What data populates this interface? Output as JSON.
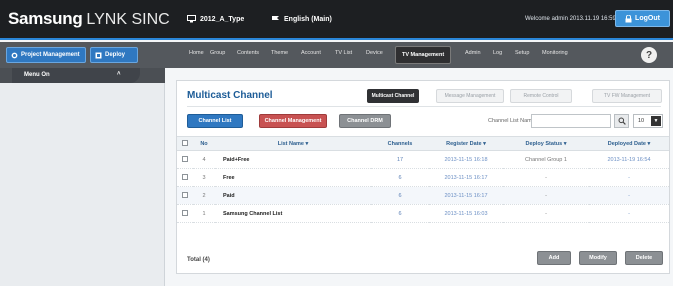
{
  "header": {
    "logo_brand": "Samsung",
    "logo_product": "LYNK SINC",
    "project": "2012_A_Type",
    "language": "English (Main)",
    "welcome": "Welcome admin 2013.11.19 16:59",
    "logout_label": "LogOut"
  },
  "sidebar": {
    "project_management_label": "Project Management",
    "deploy_label": "Deploy",
    "menu_on_label": "Menu On",
    "menu_on_arrow": "˄"
  },
  "nav": {
    "items": [
      "Home",
      "Group",
      "Contents",
      "Theme",
      "Account",
      "TV List",
      "Device",
      "TV Management",
      "Admin",
      "Log",
      "Setup",
      "Monitoring"
    ],
    "help": "?"
  },
  "panel": {
    "title": "Multicast Channel",
    "tabs": [
      "Multicast Channel",
      "Message Management",
      "Remote Control",
      "TV FW Management"
    ],
    "subtabs": [
      "Channel List",
      "Channel Management",
      "Channel DRM"
    ],
    "search_label": "Channel List Name",
    "search_value": "",
    "page_size": "10",
    "columns": [
      "No",
      "List Name ▾",
      "Channels",
      "Register Date ▾",
      "Deploy Status ▾",
      "Deployed Date ▾"
    ],
    "rows": [
      {
        "no": "4",
        "name": "Paid+Free",
        "channels": "17",
        "register": "2013-11-15 16:18",
        "status": "Channel Group 1",
        "deployed": "2013-11-19 16:54"
      },
      {
        "no": "3",
        "name": "Free",
        "channels": "6",
        "register": "2013-11-15 16:17",
        "status": "-",
        "deployed": "-"
      },
      {
        "no": "2",
        "name": "Paid",
        "channels": "6",
        "register": "2013-11-15 16:17",
        "status": "-",
        "deployed": "-"
      },
      {
        "no": "1",
        "name": "Samsung Channel List",
        "channels": "6",
        "register": "2013-11-15 16:03",
        "status": "-",
        "deployed": "-"
      }
    ],
    "total": "Total (4)",
    "actions": [
      "Add",
      "Modify",
      "Delete"
    ]
  }
}
